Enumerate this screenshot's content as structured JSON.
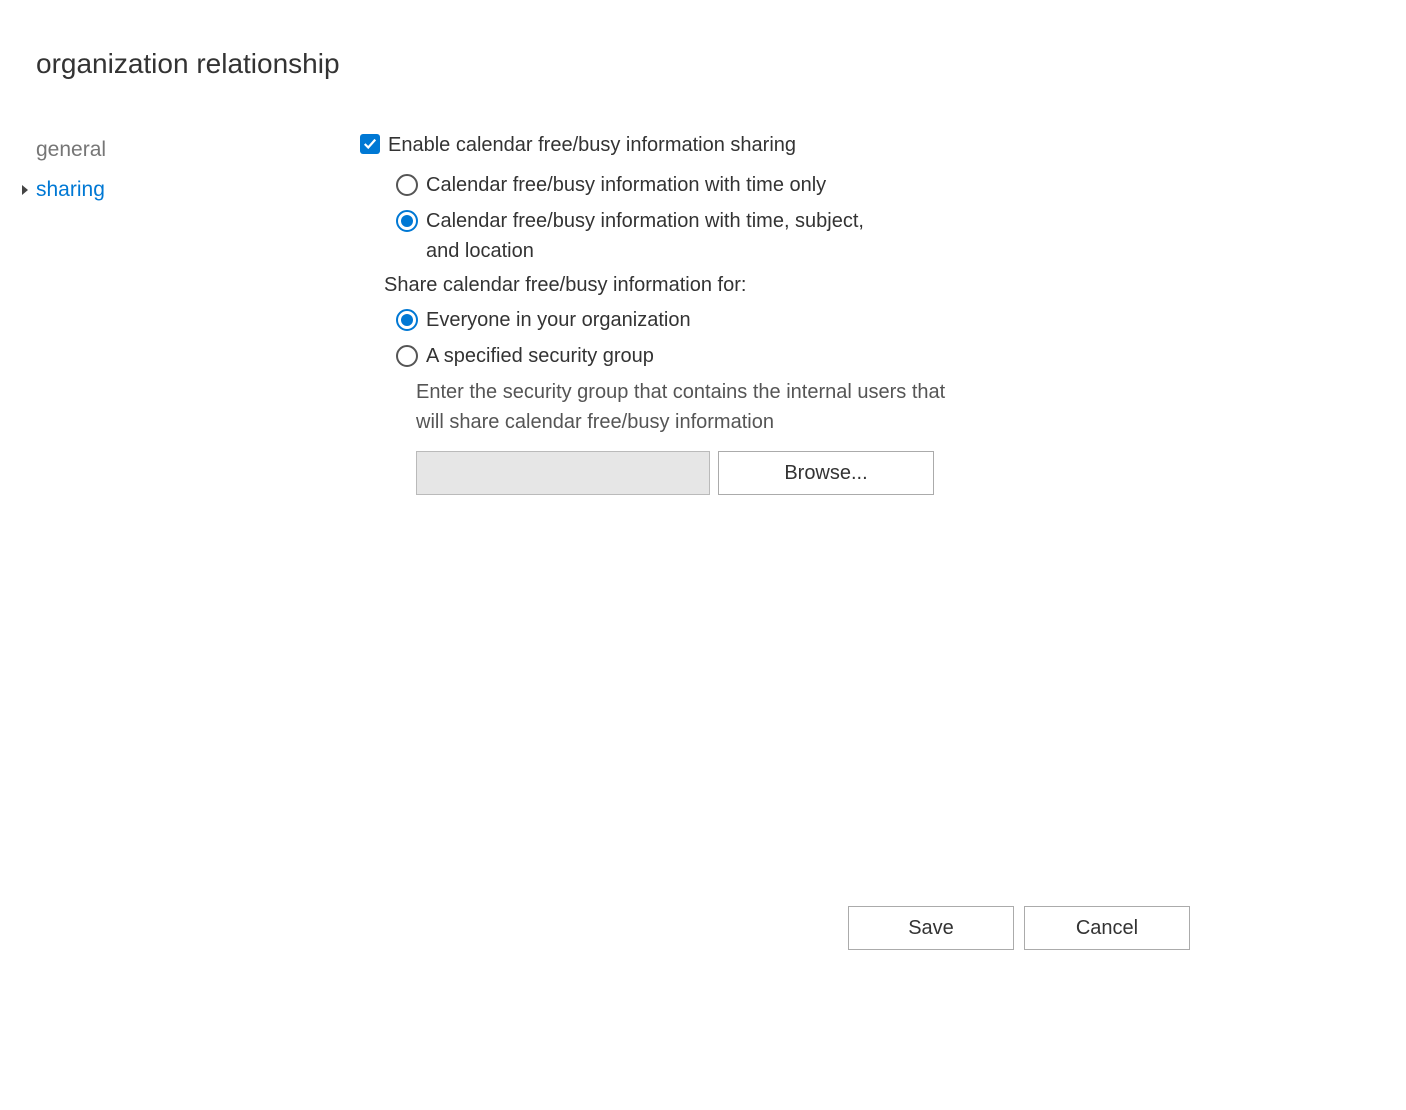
{
  "page": {
    "title": "organization relationship"
  },
  "sidebar": {
    "items": [
      {
        "label": "general",
        "active": false
      },
      {
        "label": "sharing",
        "active": true
      }
    ]
  },
  "sharing": {
    "enable_checkbox_label": "Enable calendar free/busy information sharing",
    "enable_checked": true,
    "detail_radios": {
      "time_only": "Calendar free/busy information with time only",
      "time_subject_location": "Calendar free/busy information with time, subject, and location",
      "selected": "time_subject_location"
    },
    "share_for_label": "Share calendar free/busy information for:",
    "share_for_radios": {
      "everyone": "Everyone in your organization",
      "specified_group": "A specified security group",
      "selected": "everyone"
    },
    "security_group_helper": "Enter the security group that contains the internal users that will share calendar free/busy information",
    "security_group_value": "",
    "browse_label": "Browse..."
  },
  "footer": {
    "save_label": "Save",
    "cancel_label": "Cancel"
  }
}
